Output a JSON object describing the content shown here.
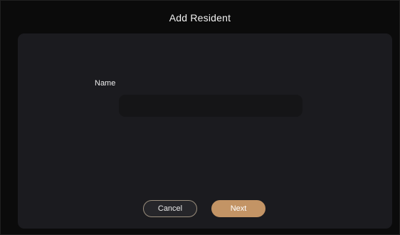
{
  "header": {
    "title": "Add Resident"
  },
  "form": {
    "name_label": "Name",
    "name_value": "",
    "name_placeholder": ""
  },
  "actions": {
    "cancel_label": "Cancel",
    "next_label": "Next"
  },
  "colors": {
    "background": "#0b0b0b",
    "panel": "#1b1b1f",
    "input": "#151517",
    "accent": "#c39465",
    "cancel_border": "#9a8e7c"
  }
}
